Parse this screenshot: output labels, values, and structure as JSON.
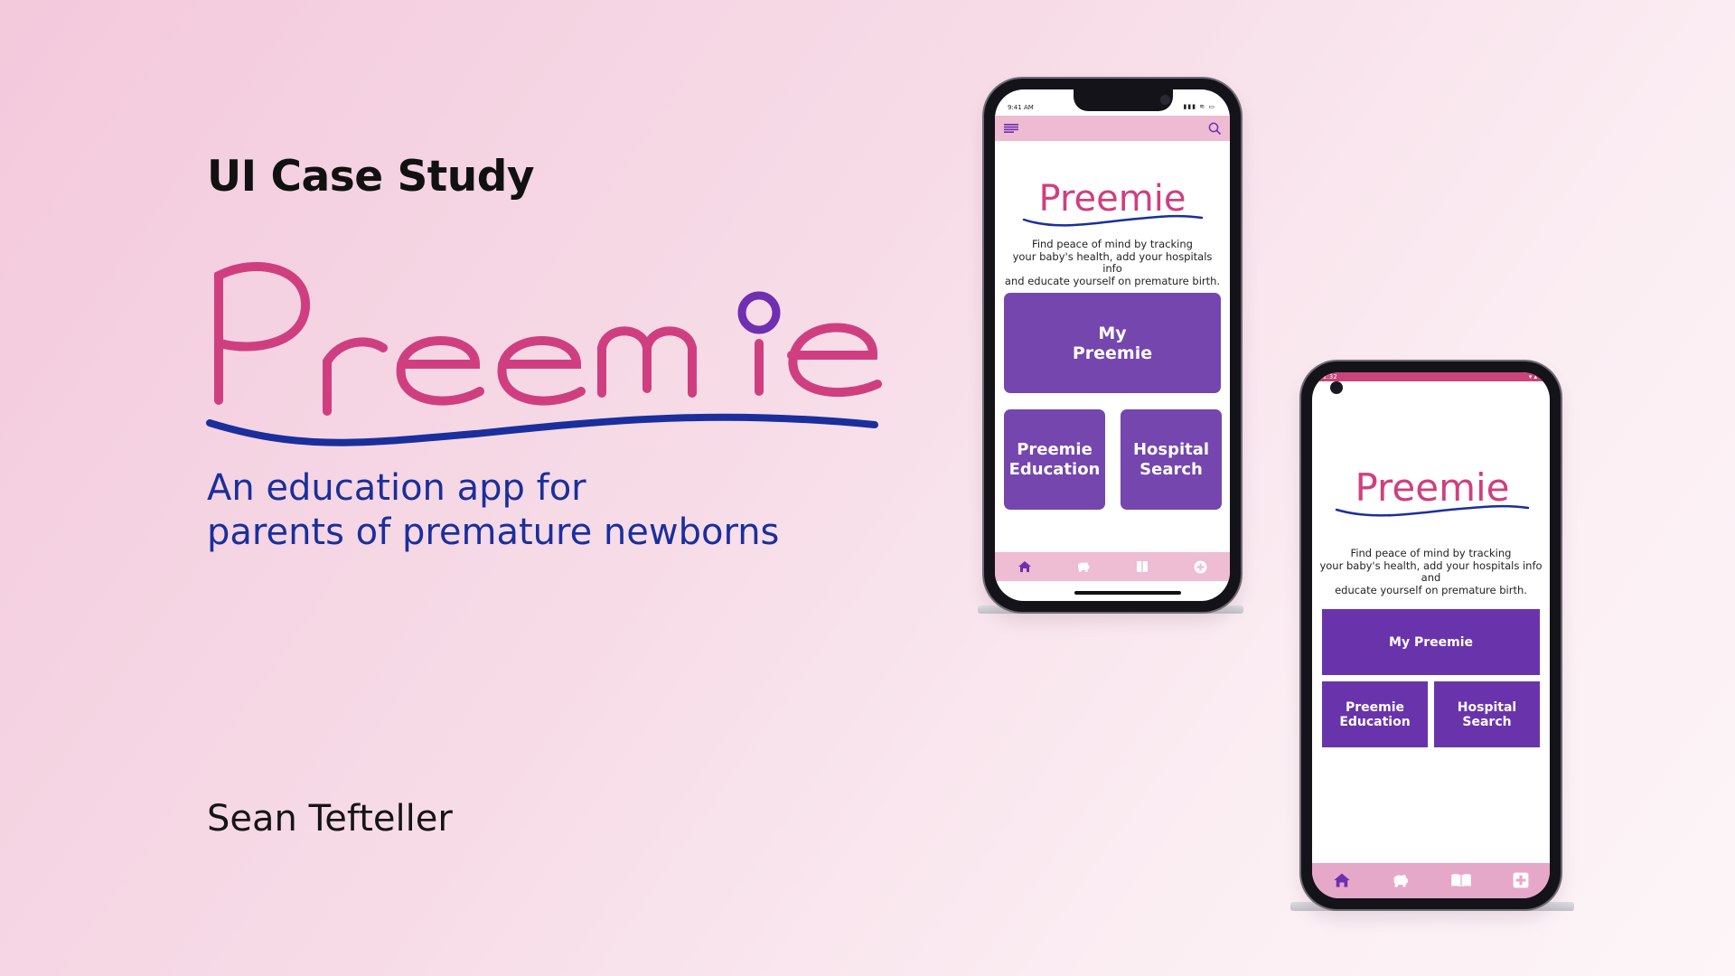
{
  "eyebrow": "UI Case Study",
  "brand": {
    "name": "Preemie",
    "primary": "#cf3f80",
    "accent": "#6e2fb0",
    "underline": "#1a2f9c"
  },
  "tagline": [
    "An education app for",
    "parents of premature newborns"
  ],
  "author": "Sean Tefteller",
  "phone_ios": {
    "status_time": "9:41 AM",
    "status_icons": "▮▮▮ ≋ ▭",
    "logo_text": "Preemie",
    "description": [
      "Find peace of mind by tracking",
      "your baby's health, add your hospitals info",
      "and educate yourself on premature birth."
    ],
    "tiles": {
      "my_preemie": [
        "My",
        "Preemie"
      ],
      "education": [
        "Preemie",
        "Education"
      ],
      "hospital": [
        "Hospital",
        "Search"
      ]
    },
    "tabs": [
      "home-icon",
      "baby-icon",
      "book-icon",
      "plus-icon"
    ]
  },
  "phone_android": {
    "status_time": "2:32",
    "status_icons": "▾ ▴",
    "logo_text": "Preemie",
    "description": [
      "Find peace of mind by tracking",
      "your baby's health, add your hospitals info and",
      "educate yourself on premature birth."
    ],
    "tiles": {
      "my_preemie": "My Preemie",
      "education": [
        "Preemie",
        "Education"
      ],
      "hospital": [
        "Hospital",
        "Search"
      ]
    },
    "tabs": [
      "home-icon",
      "baby-icon",
      "book-icon",
      "plus-icon"
    ]
  }
}
